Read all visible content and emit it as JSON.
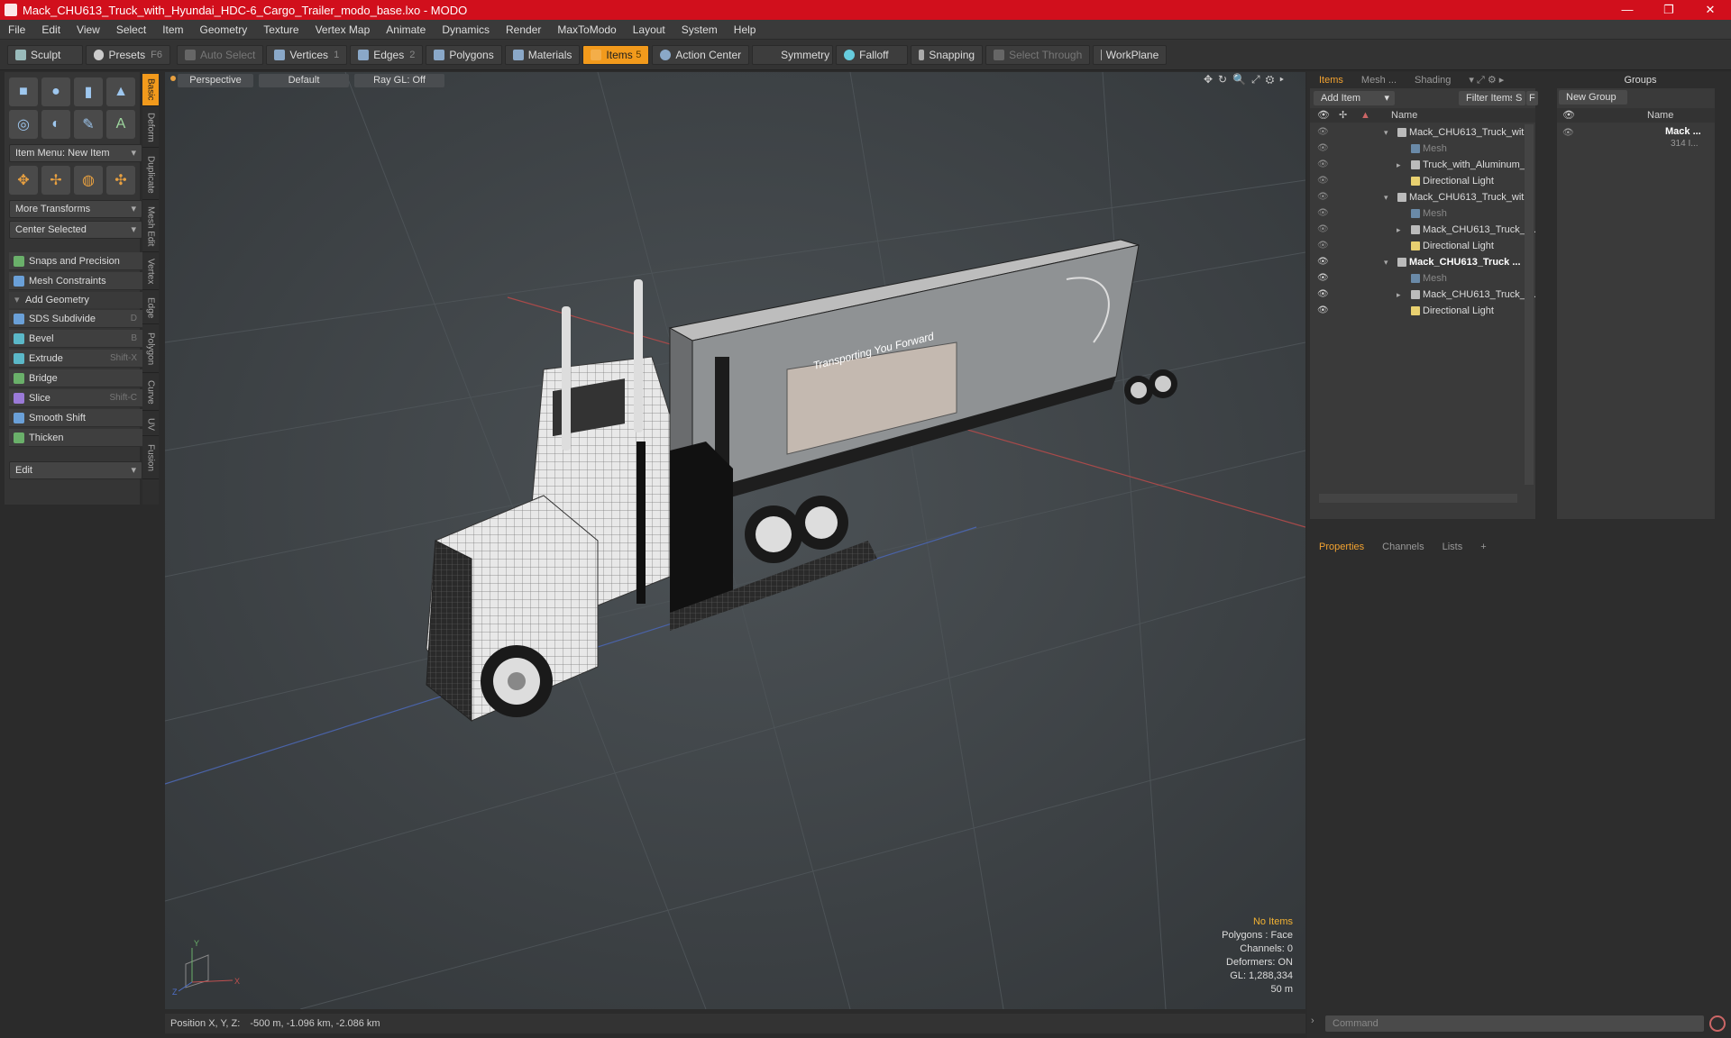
{
  "window": {
    "title": "Mack_CHU613_Truck_with_Hyundai_HDC-6_Cargo_Trailer_modo_base.lxo - MODO",
    "minimize": "—",
    "restore": "❐",
    "close": "✕"
  },
  "menu": [
    "File",
    "Edit",
    "View",
    "Select",
    "Item",
    "Geometry",
    "Texture",
    "Vertex Map",
    "Animate",
    "Dynamics",
    "Render",
    "MaxToModo",
    "Layout",
    "System",
    "Help"
  ],
  "toolbar": {
    "sculpt": "Sculpt",
    "presets": "Presets",
    "presets_key": "F6",
    "auto_select": "Auto Select",
    "vertices": "Vertices",
    "vertices_count": "1",
    "edges": "Edges",
    "edges_count": "2",
    "polygons": "Polygons",
    "materials": "Materials",
    "items": "Items",
    "items_count": "5",
    "action_center": "Action Center",
    "symmetry": "Symmetry",
    "falloff": "Falloff",
    "snapping": "Snapping",
    "select_through": "Select Through",
    "workplane": "WorkPlane"
  },
  "left": {
    "item_menu": "Item Menu: New Item",
    "more_transforms": "More Transforms",
    "center_selected": "Center Selected",
    "snaps": "Snaps and Precision",
    "mesh_constraints": "Mesh Constraints",
    "add_geometry": "Add Geometry",
    "tools": [
      {
        "label": "SDS Subdivide",
        "key": "D",
        "color": "#6aa0d8"
      },
      {
        "label": "Bevel",
        "key": "B",
        "color": "#5bb8c8"
      },
      {
        "label": "Extrude",
        "key": "Shift-X",
        "color": "#5bb8c8"
      },
      {
        "label": "Bridge",
        "key": "",
        "color": "#6ab06a"
      },
      {
        "label": "Slice",
        "key": "Shift-C",
        "color": "#9a7ad8"
      },
      {
        "label": "Smooth Shift",
        "key": "",
        "color": "#6aa0d8"
      },
      {
        "label": "Thicken",
        "key": "",
        "color": "#6ab06a"
      }
    ],
    "edit": "Edit",
    "vtabs": [
      "Basic",
      "Deform",
      "Duplicate",
      "Mesh Edit",
      "Vertex",
      "Edge",
      "Polygon",
      "Curve",
      "UV",
      "Fusion"
    ]
  },
  "viewport": {
    "view": "Perspective",
    "shading": "Default",
    "raygl": "Ray GL: Off",
    "trailer_text": "Transporting You Forward",
    "info": {
      "selection": "No Items",
      "polygons": "Polygons : Face",
      "channels": "Channels: 0",
      "deformers": "Deformers: ON",
      "gl": "GL: 1,288,334",
      "scale": "50 m"
    },
    "axes": {
      "y": "Y",
      "x": "X",
      "z": "Z"
    }
  },
  "status": {
    "position_label": "Position X, Y, Z:",
    "position_value": "-500 m, -1.096 km, -2.086 km"
  },
  "items_panel": {
    "tabs": [
      "Items",
      "Mesh ...",
      "Shading"
    ],
    "add_item": "Add Item",
    "filter": "Filter Items",
    "s": "S",
    "f": "F",
    "name_col": "Name",
    "rows": [
      {
        "name": "Mack_CHU613_Truck_wit...",
        "type": "scene",
        "level": 0,
        "style": "normal"
      },
      {
        "name": "Mesh",
        "type": "mesh",
        "level": 1,
        "style": "dim"
      },
      {
        "name": "Truck_with_Aluminum_...",
        "type": "group",
        "level": 1,
        "style": "normal"
      },
      {
        "name": "Directional Light",
        "type": "light",
        "level": 1,
        "style": "normal"
      },
      {
        "name": "Mack_CHU613_Truck_wit...",
        "type": "scene",
        "level": 0,
        "style": "normal"
      },
      {
        "name": "Mesh",
        "type": "mesh",
        "level": 1,
        "style": "dim"
      },
      {
        "name": "Mack_CHU613_Truck_ ...",
        "type": "group",
        "level": 1,
        "style": "normal"
      },
      {
        "name": "Directional Light",
        "type": "light",
        "level": 1,
        "style": "normal"
      },
      {
        "name": "Mack_CHU613_Truck ...",
        "type": "scene",
        "level": 0,
        "style": "bold"
      },
      {
        "name": "Mesh",
        "type": "mesh",
        "level": 1,
        "style": "dim"
      },
      {
        "name": "Mack_CHU613_Truck_ ...",
        "type": "group",
        "level": 1,
        "style": "normal"
      },
      {
        "name": "Directional Light",
        "type": "light",
        "level": 1,
        "style": "normal"
      }
    ]
  },
  "groups_panel": {
    "title": "Groups",
    "new_group": "New Group",
    "name_col": "Name",
    "group_name": "Mack ...",
    "group_count": "314 I..."
  },
  "props_panel": {
    "tabs": [
      "Properties",
      "Channels",
      "Lists"
    ],
    "add": "+"
  },
  "command": {
    "placeholder": "Command"
  },
  "colors": {
    "titlebar": "#d10f1c",
    "accent": "#f29a1c"
  }
}
